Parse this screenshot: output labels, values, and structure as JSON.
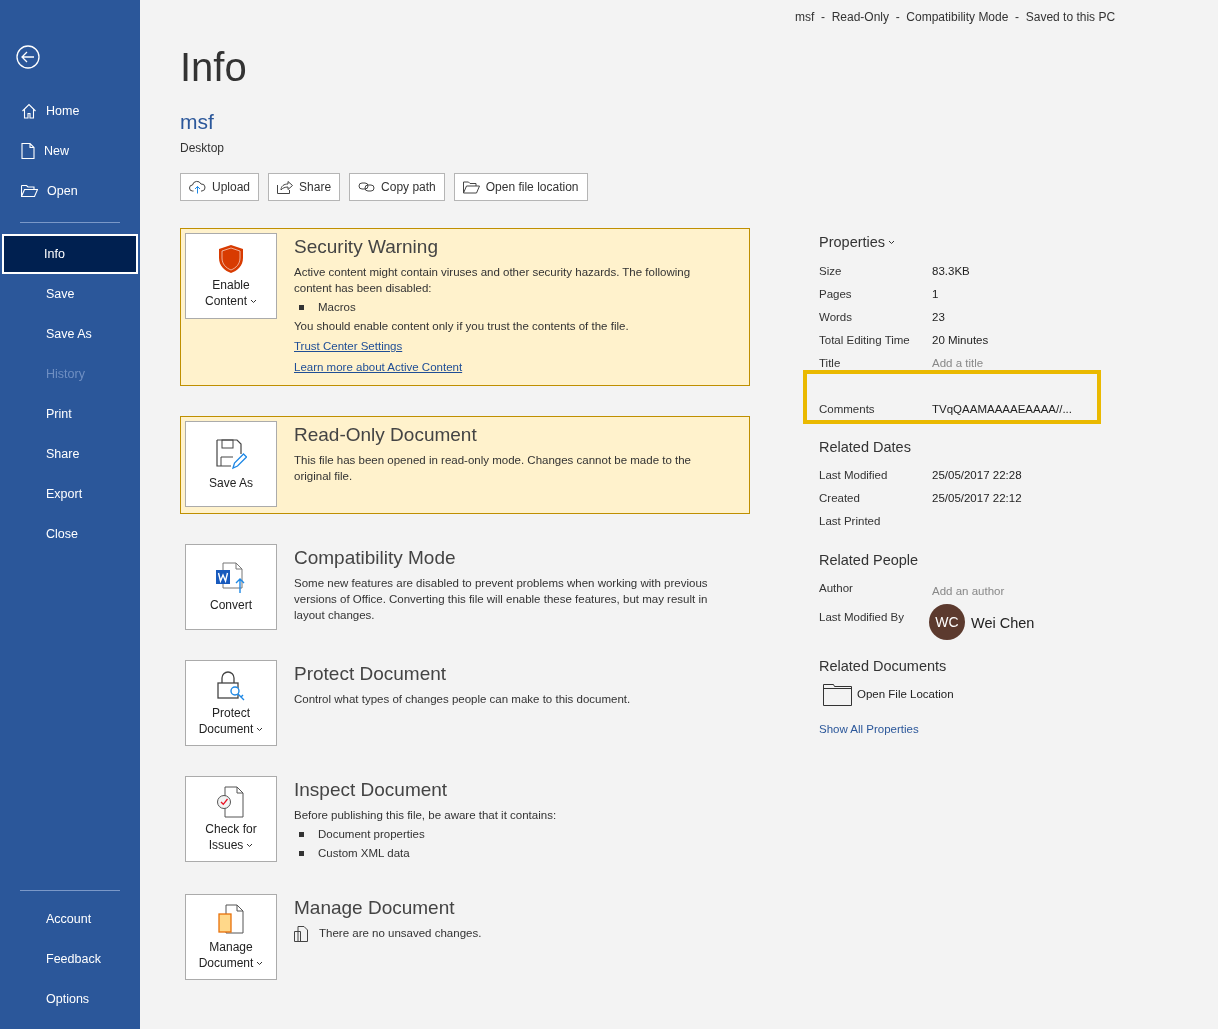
{
  "title_bar": "msf  -  Read-Only  -  Compatibility Mode  -  Saved to this PC",
  "sidebar": {
    "top": [
      {
        "label": "Home",
        "selected": false,
        "disabled": false
      },
      {
        "label": "New",
        "selected": false,
        "disabled": false
      },
      {
        "label": "Open",
        "selected": false,
        "disabled": false
      }
    ],
    "main": [
      {
        "label": "Info",
        "selected": true,
        "disabled": false
      },
      {
        "label": "Save",
        "selected": false,
        "disabled": false
      },
      {
        "label": "Save As",
        "selected": false,
        "disabled": false
      },
      {
        "label": "History",
        "selected": false,
        "disabled": true
      },
      {
        "label": "Print",
        "selected": false,
        "disabled": false
      },
      {
        "label": "Share",
        "selected": false,
        "disabled": false
      },
      {
        "label": "Export",
        "selected": false,
        "disabled": false
      },
      {
        "label": "Close",
        "selected": false,
        "disabled": false
      }
    ],
    "bottom": [
      {
        "label": "Account",
        "selected": false,
        "disabled": false
      },
      {
        "label": "Feedback",
        "selected": false,
        "disabled": false
      },
      {
        "label": "Options",
        "selected": false,
        "disabled": false
      }
    ]
  },
  "page_title": "Info",
  "file": {
    "name": "msf",
    "location": "Desktop"
  },
  "actions": [
    {
      "label": "Upload"
    },
    {
      "label": "Share"
    },
    {
      "label": "Copy path"
    },
    {
      "label": "Open file location"
    }
  ],
  "sections": [
    {
      "kind": "warning",
      "button": "Enable Content",
      "dropdown": true,
      "title": "Security Warning",
      "body": [
        {
          "kind": "text",
          "text": "Active content might contain viruses and other security hazards. The following content has been disabled:"
        },
        {
          "kind": "bullet",
          "text": "Macros"
        },
        {
          "kind": "text",
          "text": "You should enable content only if you trust the contents of the file."
        },
        {
          "kind": "link",
          "text": "Trust Center Settings"
        },
        {
          "kind": "link",
          "text": "Learn more about Active Content"
        }
      ]
    },
    {
      "kind": "warning",
      "button": "Save As",
      "dropdown": false,
      "title": "Read-Only Document",
      "body": [
        {
          "kind": "text",
          "text": "This file has been opened in read-only mode. Changes cannot be made to the original file."
        }
      ]
    },
    {
      "kind": "normal",
      "button": "Convert",
      "dropdown": false,
      "title": "Compatibility Mode",
      "body": [
        {
          "kind": "text",
          "text": "Some new features are disabled to prevent problems when working with previous versions of Office. Converting this file will enable these features, but may result in layout changes."
        }
      ]
    },
    {
      "kind": "normal",
      "button": "Protect Document",
      "dropdown": true,
      "title": "Protect Document",
      "body": [
        {
          "kind": "text",
          "text": "Control what types of changes people can make to this document."
        }
      ]
    },
    {
      "kind": "normal",
      "button": "Check for Issues",
      "dropdown": true,
      "title": "Inspect Document",
      "body": [
        {
          "kind": "text",
          "text": "Before publishing this file, be aware that it contains:"
        },
        {
          "kind": "bullet",
          "text": "Document properties"
        },
        {
          "kind": "bullet",
          "text": "Custom XML data"
        }
      ]
    },
    {
      "kind": "normal",
      "button": "Manage Document",
      "dropdown": true,
      "title": "Manage Document",
      "body": [
        {
          "kind": "status",
          "text": "There are no unsaved changes."
        }
      ]
    }
  ],
  "properties": {
    "heading": "Properties",
    "rows": [
      {
        "label": "Size",
        "value": "83.3KB",
        "empty": false,
        "highlighted": false
      },
      {
        "label": "Pages",
        "value": "1",
        "empty": false,
        "highlighted": false
      },
      {
        "label": "Words",
        "value": "23",
        "empty": false,
        "highlighted": false
      },
      {
        "label": "Total Editing Time",
        "value": "20 Minutes",
        "empty": false,
        "highlighted": false
      },
      {
        "label": "Title",
        "value": "Add a title",
        "empty": true,
        "highlighted": false
      },
      {
        "label": "Comments",
        "value": "TVqQAAMAAAAEAAAA//...",
        "empty": false,
        "highlighted": true
      }
    ]
  },
  "related_dates": {
    "heading": "Related Dates",
    "rows": [
      {
        "label": "Last Modified",
        "value": "25/05/2017 22:28"
      },
      {
        "label": "Created",
        "value": "25/05/2017 22:12"
      },
      {
        "label": "Last Printed"
      }
    ]
  },
  "related_people": {
    "heading": "Related People",
    "author_label": "Author",
    "author_placeholder": "Add an author",
    "modified_label": "Last Modified By",
    "initials": "WC",
    "name": "Wei Chen"
  },
  "related_documents": {
    "heading": "Related Documents",
    "link": "Open File Location"
  },
  "show_all": "Show All Properties"
}
